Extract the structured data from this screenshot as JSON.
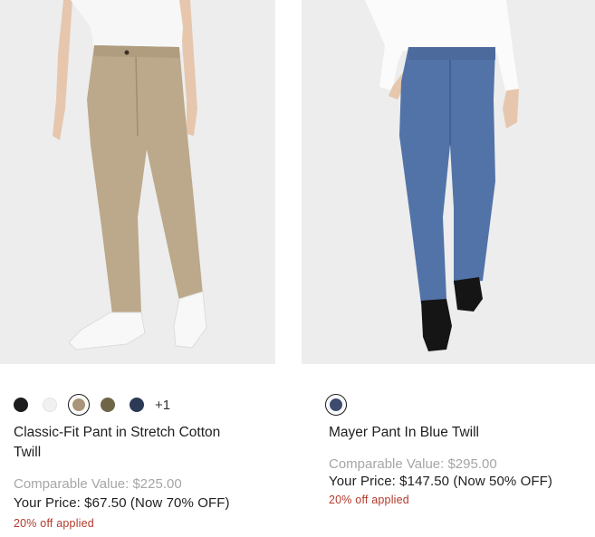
{
  "products": [
    {
      "image_alt": "Classic-Fit Pant in Stretch Cotton Twill",
      "swatches": [
        {
          "name": "black",
          "color": "#1c1c1e",
          "selected": false
        },
        {
          "name": "white",
          "color": "#f1f1f1",
          "selected": false
        },
        {
          "name": "khaki",
          "color": "#a8947a",
          "selected": true
        },
        {
          "name": "olive",
          "color": "#6f6547",
          "selected": false
        },
        {
          "name": "navy",
          "color": "#2c3a55",
          "selected": false
        }
      ],
      "more_colors": "+1",
      "title": "Classic-Fit Pant in Stretch Cotton Twill",
      "comparable": "Comparable Value: $225.00",
      "price": "Your Price: $67.50 (Now 70% OFF)",
      "discount": "20% off applied"
    },
    {
      "image_alt": "Mayer Pant In Blue Twill",
      "swatches": [
        {
          "name": "blue",
          "color": "#3d4c6e",
          "selected": true
        }
      ],
      "title": "Mayer Pant In Blue Twill",
      "comparable": "Comparable Value: $295.00",
      "price": "Your Price: $147.50 (Now 50% OFF)",
      "discount": "20% off applied"
    }
  ],
  "colors": {
    "image_bg": "#ededed",
    "discount_red": "#b33a2c",
    "muted_gray": "#a6a6a6"
  }
}
